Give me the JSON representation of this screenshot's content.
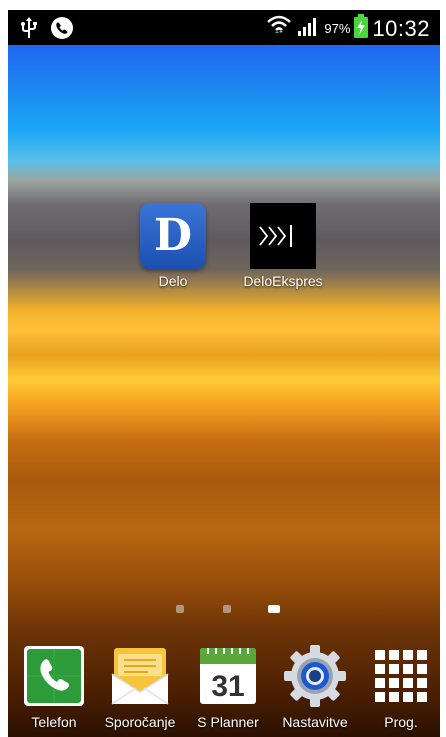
{
  "status_bar": {
    "battery_percent": "97%",
    "time": "10:32",
    "icons": [
      "usb-icon",
      "phone-call-icon",
      "wifi-icon",
      "signal-icon",
      "battery-charging-icon"
    ]
  },
  "home_apps": [
    {
      "label": "Delo",
      "icon": "delo-app-icon",
      "glyph": "D"
    },
    {
      "label": "DeloEkspres",
      "icon": "deloekspres-app-icon"
    }
  ],
  "page_indicator": {
    "pages": 3,
    "active_index": 2
  },
  "dock": [
    {
      "label": "Telefon",
      "icon": "phone-icon"
    },
    {
      "label": "Sporočanje",
      "icon": "messaging-icon"
    },
    {
      "label": "S Planner",
      "icon": "calendar-icon",
      "day": "31"
    },
    {
      "label": "Nastavitve",
      "icon": "settings-icon"
    },
    {
      "label": "Prog.",
      "icon": "apps-grid-icon"
    }
  ],
  "colors": {
    "statusbar": "#000000",
    "delo_blue": "#2a5fc4",
    "phone_green": "#2e9b3a",
    "message_yellow": "#f6c53a",
    "calendar_green": "#5aa83b"
  }
}
